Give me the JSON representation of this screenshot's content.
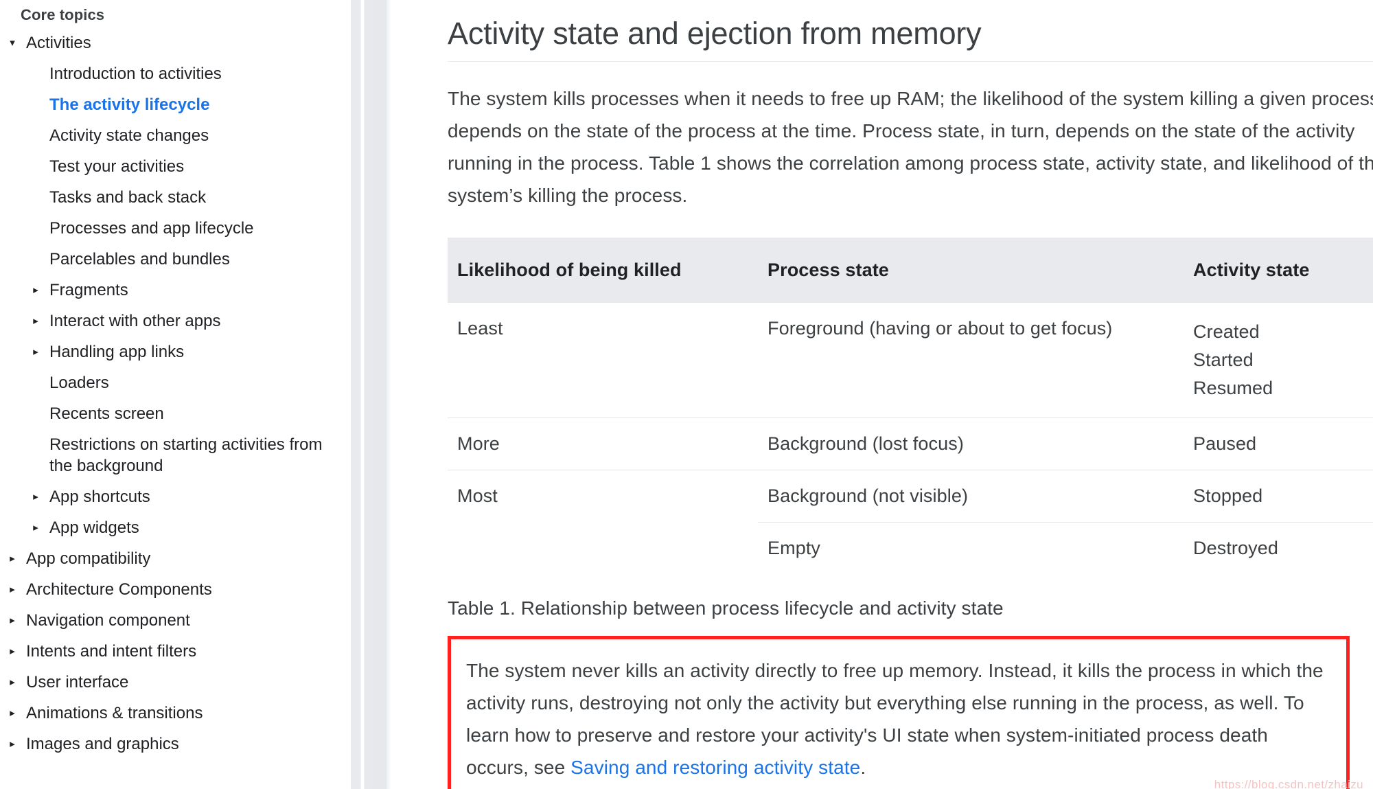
{
  "sidebar": {
    "section_title": "Core topics",
    "items": [
      {
        "label": "Activities",
        "level": 0,
        "marker": "expanded",
        "active": false
      },
      {
        "label": "Introduction to activities",
        "level": 1,
        "marker": "none",
        "active": false
      },
      {
        "label": "The activity lifecycle",
        "level": 1,
        "marker": "none",
        "active": true
      },
      {
        "label": "Activity state changes",
        "level": 1,
        "marker": "none",
        "active": false
      },
      {
        "label": "Test your activities",
        "level": 1,
        "marker": "none",
        "active": false
      },
      {
        "label": "Tasks and back stack",
        "level": 1,
        "marker": "none",
        "active": false
      },
      {
        "label": "Processes and app lifecycle",
        "level": 1,
        "marker": "none",
        "active": false
      },
      {
        "label": "Parcelables and bundles",
        "level": 1,
        "marker": "none",
        "active": false
      },
      {
        "label": "Fragments",
        "level": 1,
        "marker": "collapsed",
        "active": false
      },
      {
        "label": "Interact with other apps",
        "level": 1,
        "marker": "collapsed",
        "active": false
      },
      {
        "label": "Handling app links",
        "level": 1,
        "marker": "collapsed",
        "active": false
      },
      {
        "label": "Loaders",
        "level": 1,
        "marker": "none",
        "active": false
      },
      {
        "label": "Recents screen",
        "level": 1,
        "marker": "none",
        "active": false
      },
      {
        "label": "Restrictions on starting activities from the background",
        "level": 1,
        "marker": "none",
        "active": false
      },
      {
        "label": "App shortcuts",
        "level": 1,
        "marker": "collapsed",
        "active": false
      },
      {
        "label": "App widgets",
        "level": 1,
        "marker": "collapsed",
        "active": false
      },
      {
        "label": "App compatibility",
        "level": 0,
        "marker": "collapsed",
        "active": false
      },
      {
        "label": "Architecture Components",
        "level": 0,
        "marker": "collapsed",
        "active": false
      },
      {
        "label": "Navigation component",
        "level": 0,
        "marker": "collapsed",
        "active": false
      },
      {
        "label": "Intents and intent filters",
        "level": 0,
        "marker": "collapsed",
        "active": false
      },
      {
        "label": "User interface",
        "level": 0,
        "marker": "collapsed",
        "active": false
      },
      {
        "label": "Animations & transitions",
        "level": 0,
        "marker": "collapsed",
        "active": false
      },
      {
        "label": "Images and graphics",
        "level": 0,
        "marker": "collapsed",
        "active": false
      }
    ],
    "expanded_marker": "▾",
    "collapsed_marker": "▸"
  },
  "main": {
    "title": "Activity state and ejection from memory",
    "intro_paragraph": "The system kills processes when it needs to free up RAM; the likelihood of the system killing a given process depends on the state of the process at the time. Process state, in turn, depends on the state of the activity running in the process. Table 1 shows the correlation among process state, activity state, and likelihood of the system’s killing the process.",
    "table": {
      "headers": [
        "Likelihood of being killed",
        "Process state",
        "Activity state"
      ],
      "rows": [
        {
          "likelihood": "Least",
          "process_state": "Foreground (having or about to get focus)",
          "activity_state": "Created\nStarted\nResumed"
        },
        {
          "likelihood": "More",
          "process_state": "Background (lost focus)",
          "activity_state": "Paused"
        },
        {
          "likelihood": "Most",
          "process_state": "Background (not visible)",
          "activity_state": "Stopped"
        },
        {
          "likelihood": "",
          "process_state": "Empty",
          "activity_state": "Destroyed"
        }
      ]
    },
    "caption": "Table 1. Relationship between process lifecycle and activity state",
    "callout": {
      "text_before_link": "The system never kills an activity directly to free up memory. Instead, it kills the process in which the activity runs, destroying not only the activity but everything else running in the process, as well. To learn how to preserve and restore your activity's UI state when system-initiated process death occurs, see ",
      "link_text": "Saving and restoring activity state",
      "text_after_link": ".",
      "border_color": "#ff2020"
    },
    "watermark": "https://blog.csdn.net/zhaizu"
  },
  "theme": {
    "link_color": "#1a73e8",
    "text_color": "#3c4043",
    "table_header_bg": "#e8eaed",
    "rule_color": "#e3e5e8"
  }
}
